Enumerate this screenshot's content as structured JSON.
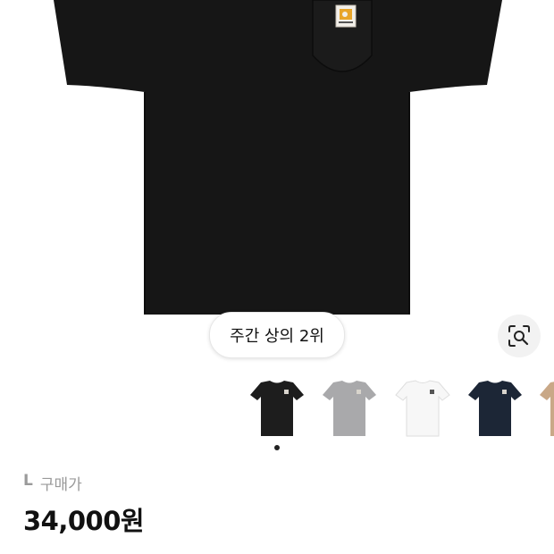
{
  "product": {
    "ranking_badge": "주간 상의 2위",
    "size_label": "L",
    "price_label": "구매가",
    "price": "34,000원",
    "colors": {
      "black": "#1d1d1d",
      "gray": "#a9a9ab",
      "white": "#f7f7f7",
      "navy": "#1c2636",
      "tan": "#c9a887"
    },
    "active_thumbnail": 0,
    "thumbnails": [
      {
        "name": "thumbnail-black",
        "color": "black"
      },
      {
        "name": "thumbnail-gray",
        "color": "gray"
      },
      {
        "name": "thumbnail-white",
        "color": "white"
      },
      {
        "name": "thumbnail-navy",
        "color": "navy"
      },
      {
        "name": "thumbnail-tan",
        "color": "tan"
      }
    ]
  },
  "icons": {
    "image_search": "image-search-icon"
  }
}
